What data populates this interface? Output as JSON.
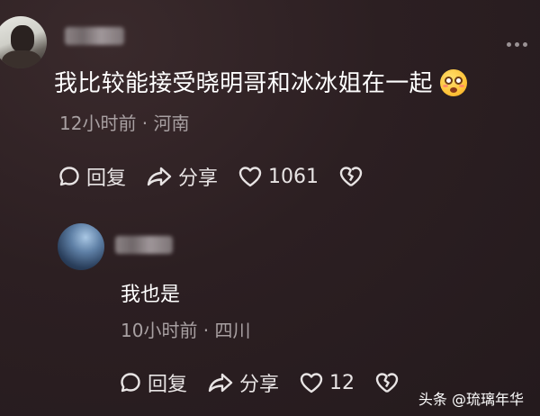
{
  "comment": {
    "text": "我比较能接受晓明哥和冰冰姐在一起",
    "meta": "12小时前 · 河南",
    "reply_label": "回复",
    "share_label": "分享",
    "like_count": "1061"
  },
  "reply": {
    "text": "我也是",
    "meta": "10小时前 · 四川",
    "reply_label": "回复",
    "share_label": "分享",
    "like_count": "12"
  },
  "watermark": "头条 @琉璃年华",
  "icons": {
    "emoji": "flushed-smile-emoji",
    "reply": "speech-bubble-icon",
    "share": "share-arrow-icon",
    "like": "heart-icon",
    "dislike": "broken-heart-icon",
    "more": "more-dots-icon"
  }
}
